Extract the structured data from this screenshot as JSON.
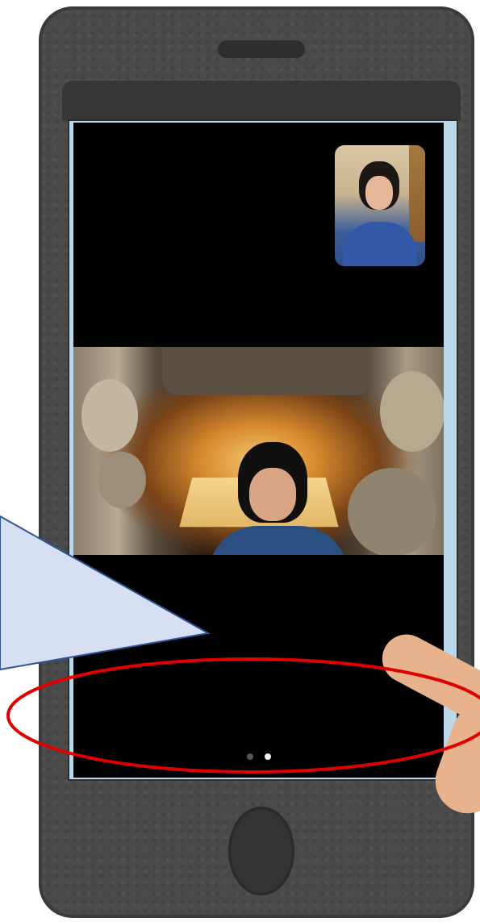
{
  "screen": {
    "pager": {
      "page_count": 2,
      "current_page": 2
    },
    "self_view": {
      "icon": "video-thumbnail"
    },
    "main_view": {
      "icon": "video-feed"
    }
  },
  "annotations": {
    "highlight_color": "#e00000",
    "callout_fill": "#d6e0f2",
    "callout_stroke": "#2f5597"
  }
}
